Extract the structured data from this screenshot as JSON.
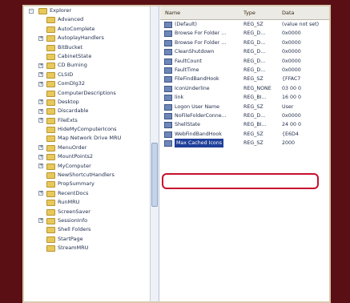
{
  "tree": {
    "root_label": "Explorer",
    "items": [
      {
        "label": "Advanced",
        "exp": ""
      },
      {
        "label": "AutoComplete",
        "exp": ""
      },
      {
        "label": "AutoplayHandlers",
        "exp": "+"
      },
      {
        "label": "BitBucket",
        "exp": ""
      },
      {
        "label": "CabinetState",
        "exp": ""
      },
      {
        "label": "CD Burning",
        "exp": "+"
      },
      {
        "label": "CLSID",
        "exp": "+"
      },
      {
        "label": "ComDlg32",
        "exp": "+"
      },
      {
        "label": "ComputerDescriptions",
        "exp": ""
      },
      {
        "label": "Desktop",
        "exp": "+"
      },
      {
        "label": "Discardable",
        "exp": "+"
      },
      {
        "label": "FileExts",
        "exp": "+"
      },
      {
        "label": "HideMyComputerIcons",
        "exp": ""
      },
      {
        "label": "Map Network Drive MRU",
        "exp": ""
      },
      {
        "label": "MenuOrder",
        "exp": "+"
      },
      {
        "label": "MountPoints2",
        "exp": "+"
      },
      {
        "label": "MyComputer",
        "exp": "+"
      },
      {
        "label": "NewShortcutHandlers",
        "exp": ""
      },
      {
        "label": "PropSummary",
        "exp": ""
      },
      {
        "label": "RecentDocs",
        "exp": "+"
      },
      {
        "label": "RunMRU",
        "exp": ""
      },
      {
        "label": "ScreenSaver",
        "exp": ""
      },
      {
        "label": "SessionInfo",
        "exp": "+"
      },
      {
        "label": "Shell Folders",
        "exp": ""
      },
      {
        "label": "StartPage",
        "exp": ""
      },
      {
        "label": "StreamMRU",
        "exp": ""
      }
    ]
  },
  "list": {
    "headers": {
      "name": "Name",
      "type": "Type",
      "data": "Data"
    },
    "rows": [
      {
        "name": "(Default)",
        "type": "REG_SZ",
        "data": "(value not set)"
      },
      {
        "name": "Browse For Folder ...",
        "type": "REG_D...",
        "data": "0x0000"
      },
      {
        "name": "Browse For Folder ...",
        "type": "REG_D...",
        "data": "0x0000"
      },
      {
        "name": "CleanShutdown",
        "type": "REG_D...",
        "data": "0x0000"
      },
      {
        "name": "FaultCount",
        "type": "REG_D...",
        "data": "0x0000"
      },
      {
        "name": "FaultTime",
        "type": "REG_D...",
        "data": "0x0000"
      },
      {
        "name": "FileFindBandHook",
        "type": "REG_SZ",
        "data": "{FFAC7"
      },
      {
        "name": "IconUnderline",
        "type": "REG_NONE",
        "data": "03 00 0"
      },
      {
        "name": "link",
        "type": "REG_BI...",
        "data": "16 00 0"
      },
      {
        "name": "Logon User Name",
        "type": "REG_SZ",
        "data": "User"
      },
      {
        "name": "NoFileFolderConne...",
        "type": "REG_D...",
        "data": "0x0000"
      },
      {
        "name": "ShellState",
        "type": "REG_BI...",
        "data": "24 00 0"
      },
      {
        "name": "WebFindBandHook",
        "type": "REG_SZ",
        "data": "{E6D4"
      },
      {
        "name": "Max Cached Icons",
        "type": "REG_SZ",
        "data": "2000",
        "selected": true
      }
    ]
  }
}
